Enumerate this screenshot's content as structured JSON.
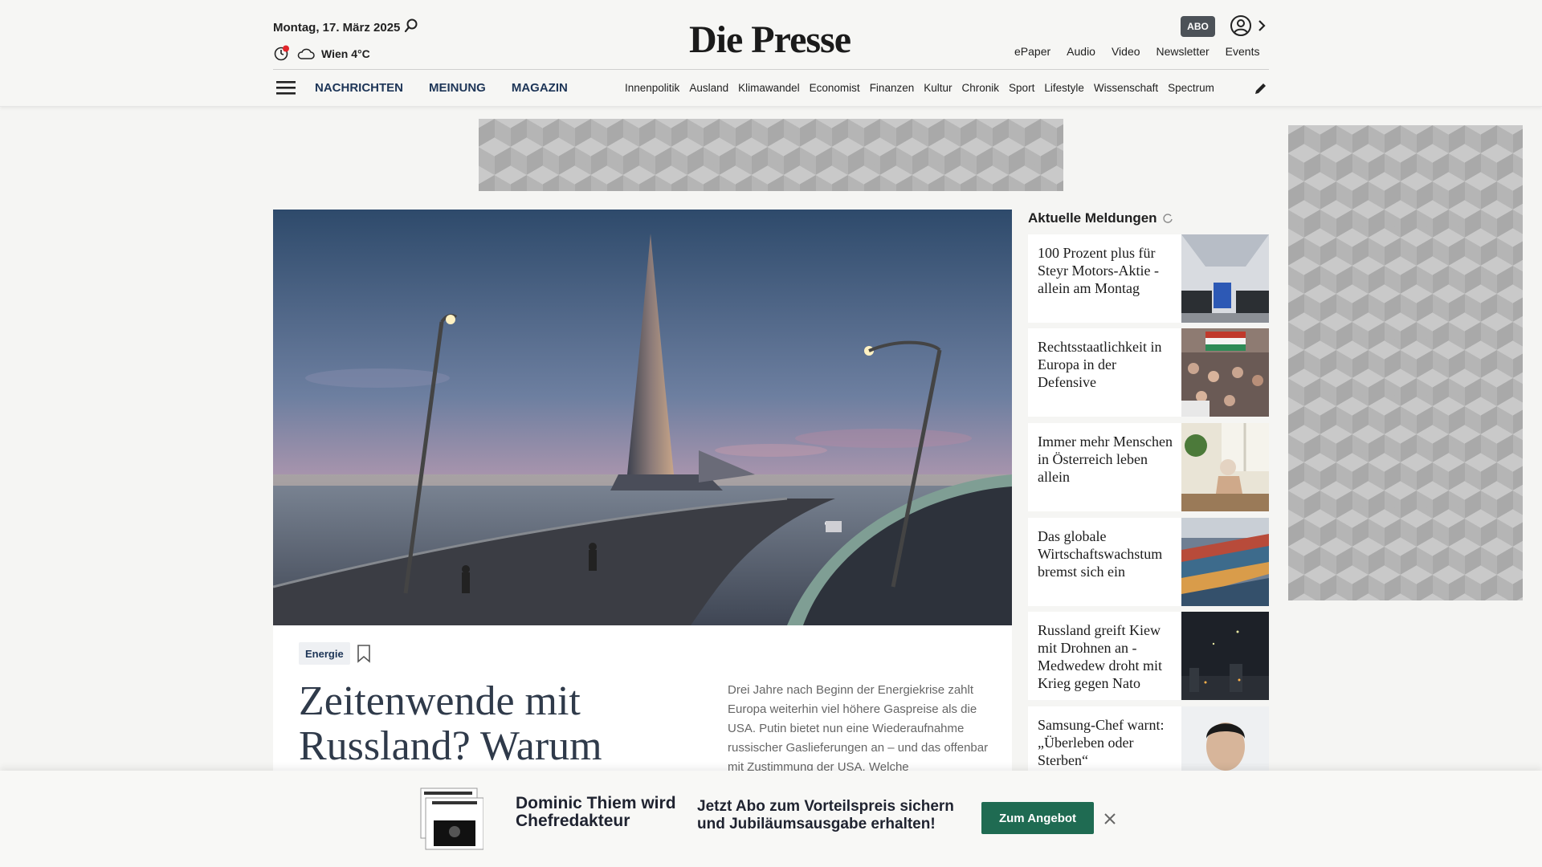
{
  "header": {
    "date": "Montag, 17. März 2025",
    "weather": "Wien 4°C",
    "logo": "Die Presse",
    "abo": "ABO",
    "toplinks": [
      "ePaper",
      "Audio",
      "Video",
      "Newsletter",
      "Events"
    ],
    "mainnav": [
      "NACHRICHTEN",
      "MEINUNG",
      "MAGAZIN"
    ],
    "subnav": [
      "Innenpolitik",
      "Ausland",
      "Klimawandel",
      "Economist",
      "Finanzen",
      "Kultur",
      "Chronik",
      "Sport",
      "Lifestyle",
      "Wissenschaft",
      "Spectrum"
    ]
  },
  "article": {
    "tag": "Energie",
    "headline": "Zeitenwende mit Russland? Warum",
    "teaser": "Drei Jahre nach Beginn der Energiekrise zahlt Europa weiterhin viel höhere Gaspreise als die USA. Putin bietet nun eine Wiederaufnahme russischer Gaslieferungen an – und das offenbar mit Zustimmung der USA. Welche"
  },
  "sidebar": {
    "title": "Aktuelle Meldungen",
    "items": [
      {
        "text": "100 Prozent plus für Steyr Motors-Aktie - allein am Montag"
      },
      {
        "text": "Rechtsstaatlichkeit in Europa in der Defensive"
      },
      {
        "text": "Immer mehr Menschen in Österreich leben allein"
      },
      {
        "text": "Das globale Wirtschaftswachstum bremst sich ein"
      },
      {
        "text": "Russland greift Kiew mit Drohnen an - Medwedew droht mit Krieg gegen Nato"
      },
      {
        "text": "Samsung-Chef warnt: „Überleben oder Sterben“"
      }
    ]
  },
  "banner": {
    "name": "Dominic Thiem wird Chefredakteur",
    "offer": "Jetzt Abo zum Vorteilspreis sichern und Jubiläumsausgabe erhalten!",
    "cta": "Zum Angebot"
  },
  "icons": {
    "search": "search-icon",
    "weather": "cloud-icon",
    "user": "user-icon",
    "menu": "menu-icon",
    "edit": "pencil-icon",
    "bookmark": "bookmark-icon",
    "close": "close-icon"
  },
  "colors": {
    "accent_nav": "#1d3557",
    "cta": "#1f6b52",
    "abo_badge": "#4c5258"
  }
}
